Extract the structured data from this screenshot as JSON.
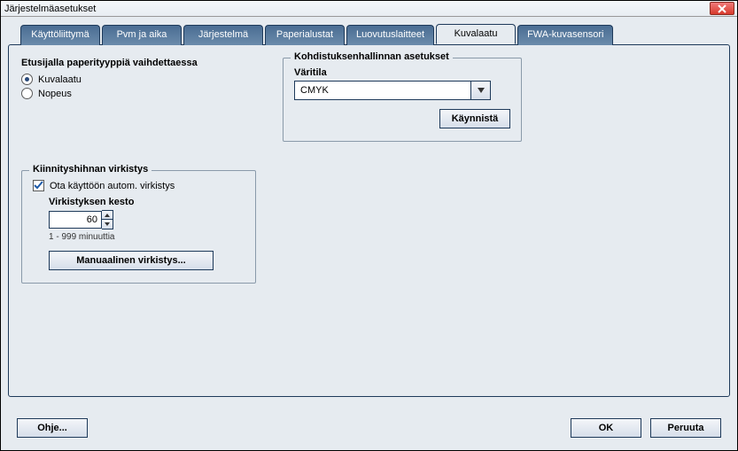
{
  "window": {
    "title": "Järjestelmäasetukset"
  },
  "tabs": {
    "items": [
      {
        "label": "Käyttöliittymä"
      },
      {
        "label": "Pvm ja aika"
      },
      {
        "label": "Järjestelmä"
      },
      {
        "label": "Paperialustat"
      },
      {
        "label": "Luovutuslaitteet"
      },
      {
        "label": "Kuvalaatu"
      },
      {
        "label": "FWA-kuvasensori"
      }
    ],
    "active_index": 5
  },
  "priority": {
    "title": "Etusijalla paperityyppiä vaihdettaessa",
    "options": [
      {
        "label": "Kuvalaatu",
        "checked": true
      },
      {
        "label": "Nopeus",
        "checked": false
      }
    ]
  },
  "registration": {
    "title": "Kohdistuksenhallinnan asetukset",
    "color_mode_label": "Väritila",
    "color_mode_value": "CMYK",
    "start_button": "Käynnistä"
  },
  "refresh": {
    "title": "Kiinnityshihnan virkistys",
    "auto_label": "Ota käyttöön autom. virkistys",
    "auto_checked": true,
    "duration_label": "Virkistyksen kesto",
    "duration_value": "60",
    "duration_hint": "1 - 999 minuuttia",
    "manual_button": "Manuaalinen virkistys..."
  },
  "footer": {
    "help": "Ohje...",
    "ok": "OK",
    "cancel": "Peruuta"
  }
}
